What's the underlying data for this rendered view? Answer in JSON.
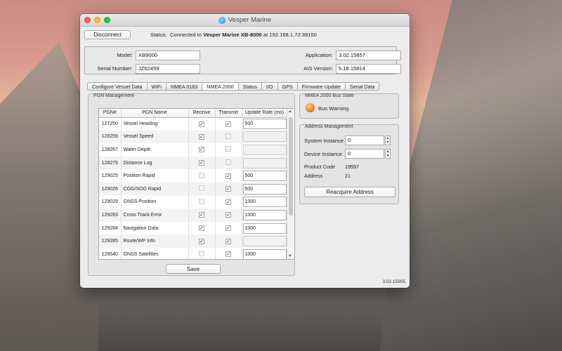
{
  "window": {
    "title": "Vesper Marine"
  },
  "toolbar": {
    "disconnect_label": "Disconnect",
    "status_prefix": "Status:",
    "status_text": "Connected to",
    "status_device": "Vesper Marine XB-8000",
    "status_address": "at 192.168.1.72:39150"
  },
  "device": {
    "model_label": "Model:",
    "model_value": "XB9000",
    "serial_label": "Serial Number:",
    "serial_value": "JZ62459",
    "application_label": "Application:",
    "application_value": "3.02.15857",
    "ais_label": "AIS Version:",
    "ais_value": "5.18.15814"
  },
  "tabs": [
    {
      "label": "Configure Vessel Data",
      "active": false
    },
    {
      "label": "WiFi",
      "active": false
    },
    {
      "label": "NMEA 0183",
      "active": false
    },
    {
      "label": "NMEA 2000",
      "active": true
    },
    {
      "label": "Status",
      "active": false
    },
    {
      "label": "I/O",
      "active": false
    },
    {
      "label": "GPS",
      "active": false
    },
    {
      "label": "Firmware Update",
      "active": false
    },
    {
      "label": "Serial Data",
      "active": false
    }
  ],
  "pgn_management": {
    "title": "PGN Management",
    "columns": [
      "PGN#",
      "PGN Name",
      "Receive",
      "Transmit",
      "Update Rate (ms)"
    ],
    "rows": [
      {
        "pgn": "127250",
        "name": "Vessel Heading",
        "receive": true,
        "receive_enabled": true,
        "transmit": true,
        "transmit_enabled": true,
        "rate": "500",
        "rate_enabled": true
      },
      {
        "pgn": "128259",
        "name": "Vessel Speed",
        "receive": true,
        "receive_enabled": true,
        "transmit": false,
        "transmit_enabled": false,
        "rate": "",
        "rate_enabled": false
      },
      {
        "pgn": "128267",
        "name": "Water Depth",
        "receive": true,
        "receive_enabled": true,
        "transmit": false,
        "transmit_enabled": false,
        "rate": "",
        "rate_enabled": false
      },
      {
        "pgn": "128275",
        "name": "Distance Log",
        "receive": true,
        "receive_enabled": true,
        "transmit": false,
        "transmit_enabled": false,
        "rate": "",
        "rate_enabled": false
      },
      {
        "pgn": "129025",
        "name": "Position Rapid",
        "receive": false,
        "receive_enabled": false,
        "transmit": true,
        "transmit_enabled": true,
        "rate": "500",
        "rate_enabled": true
      },
      {
        "pgn": "129026",
        "name": "COG/SOG Rapid",
        "receive": false,
        "receive_enabled": false,
        "transmit": true,
        "transmit_enabled": true,
        "rate": "500",
        "rate_enabled": true
      },
      {
        "pgn": "129029",
        "name": "GNSS Position",
        "receive": false,
        "receive_enabled": false,
        "transmit": true,
        "transmit_enabled": true,
        "rate": "1000",
        "rate_enabled": true
      },
      {
        "pgn": "129283",
        "name": "Cross Track Error",
        "receive": true,
        "receive_enabled": true,
        "transmit": true,
        "transmit_enabled": true,
        "rate": "1000",
        "rate_enabled": true
      },
      {
        "pgn": "129284",
        "name": "Navigation Data",
        "receive": true,
        "receive_enabled": true,
        "transmit": true,
        "transmit_enabled": true,
        "rate": "1000",
        "rate_enabled": true
      },
      {
        "pgn": "129285",
        "name": "Route/WP Info",
        "receive": true,
        "receive_enabled": true,
        "transmit": true,
        "transmit_enabled": true,
        "rate": "",
        "rate_enabled": false
      },
      {
        "pgn": "129540",
        "name": "GNSS Satellites",
        "receive": false,
        "receive_enabled": false,
        "transmit": true,
        "transmit_enabled": true,
        "rate": "1000",
        "rate_enabled": true
      }
    ],
    "save_label": "Save"
  },
  "bus_state": {
    "title": "NMEA 2000 Bus State",
    "status": "Bus Warning",
    "status_color": "#f07a1e",
    "icon": "warning-status-icon"
  },
  "address_management": {
    "title": "Address Management",
    "system_instance_label": "System Instance",
    "system_instance_value": "0",
    "device_instance_label": "Device Instance",
    "device_instance_value": "0",
    "product_code_label": "Product Code",
    "product_code_value": "19597",
    "address_label": "Address",
    "address_value": "21",
    "reacquire_label": "Reacquire Address"
  },
  "footer": {
    "version": "3.02.15905"
  }
}
